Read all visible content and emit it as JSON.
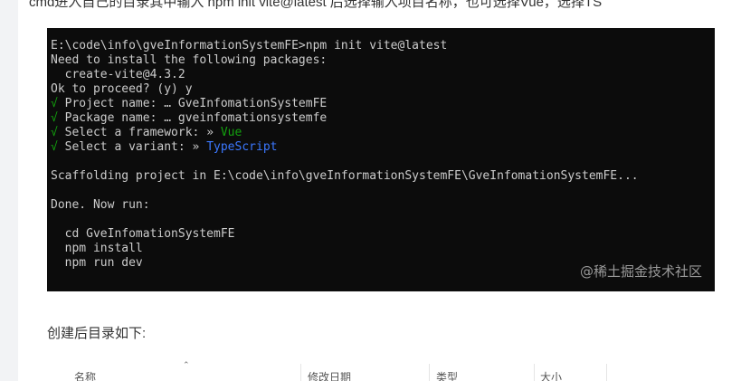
{
  "article": {
    "top_line": "cmd进入自己的目录其中输入 npm init vite@latest 后选择输入项目名称，也可选择Vue，选择TS",
    "after_terminal_text": "创建后目录如下:"
  },
  "terminal": {
    "lines": [
      "E:\\code\\info\\gveInformationSystemFE>npm init vite@latest",
      "Need to install the following packages:",
      "  create-vite@4.3.2",
      "Ok to proceed? (y) y",
      "√ Project name: … GveInfomationSystemFE",
      "√ Package name: … gveinfomationsystemfe",
      "√ Select a framework: » Vue",
      "√ Select a variant: » TypeScript",
      "",
      "Scaffolding project in E:\\code\\info\\gveInformationSystemFE\\GveInfomationSystemFE...",
      "",
      "Done. Now run:",
      "",
      "  cd GveInfomationSystemFE",
      "  npm install",
      "  npm run dev"
    ],
    "watermark": "@稀土掘金技术社区",
    "colors": {
      "background": "#0c0c0c",
      "text": "#cccccc",
      "success": "#13a10e",
      "link": "#3b78ff"
    }
  },
  "explorer": {
    "columns": [
      "名称",
      "修改日期",
      "类型",
      "大小"
    ]
  }
}
